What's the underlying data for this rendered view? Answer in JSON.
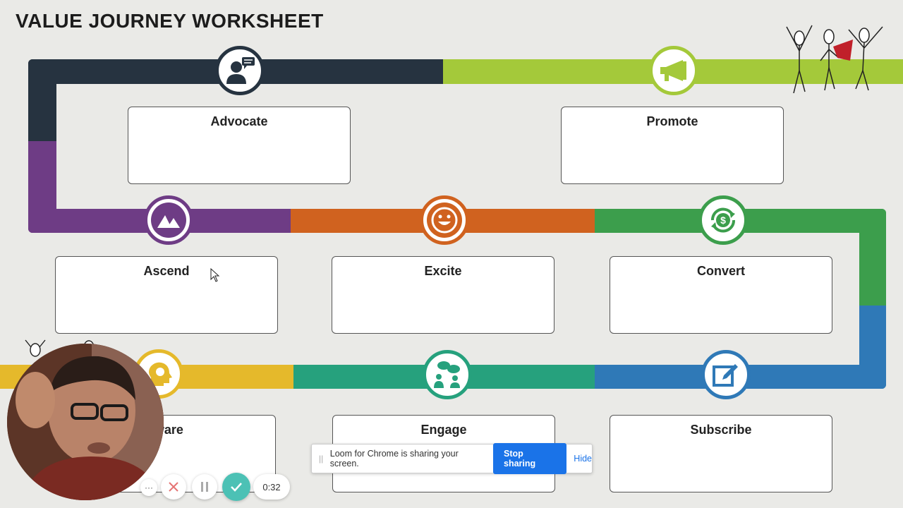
{
  "title": "VALUE JOURNEY WORKSHEET",
  "stages": {
    "advocate": "Advocate",
    "promote": "Promote",
    "ascend": "Ascend",
    "excite": "Excite",
    "convert": "Convert",
    "aware": "Aware",
    "engage": "Engage",
    "subscribe": "Subscribe"
  },
  "colors": {
    "advocate": "#263340",
    "promote": "#a4c93a",
    "ascend": "#6e3c85",
    "excite": "#d0621f",
    "convert": "#3c9e4c",
    "aware": "#e5b92b",
    "engage": "#26a17d",
    "subscribe": "#2f79b7"
  },
  "loom": {
    "message": "Loom for Chrome is sharing your screen.",
    "stop_label": "Stop sharing",
    "hide_label": "Hide"
  },
  "recorder": {
    "more_label": "···",
    "timer": "0:32"
  }
}
